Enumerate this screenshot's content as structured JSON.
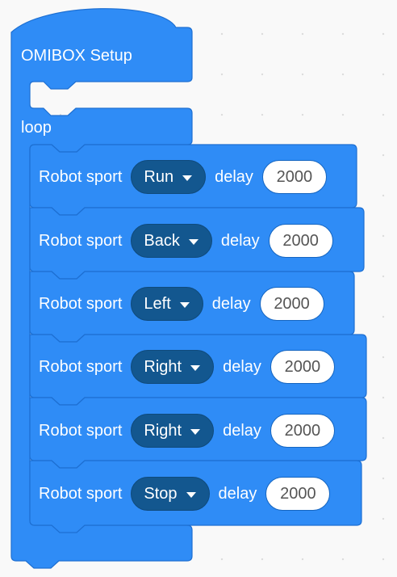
{
  "setup": {
    "title": "OMIBOX Setup"
  },
  "loop": {
    "title": "loop"
  },
  "blocks": [
    {
      "label": "Robot sport",
      "direction": "Run",
      "delay_label": "delay",
      "delay": "2000"
    },
    {
      "label": "Robot sport",
      "direction": "Back",
      "delay_label": "delay",
      "delay": "2000"
    },
    {
      "label": "Robot sport",
      "direction": "Left",
      "delay_label": "delay",
      "delay": "2000"
    },
    {
      "label": "Robot sport",
      "direction": "Right",
      "delay_label": "delay",
      "delay": "2000"
    },
    {
      "label": "Robot sport",
      "direction": "Right",
      "delay_label": "delay",
      "delay": "2000"
    },
    {
      "label": "Robot sport",
      "direction": "Stop",
      "delay_label": "delay",
      "delay": "2000"
    }
  ],
  "colors": {
    "block": "#2f8cf6",
    "block_border": "#1d6fd2",
    "dropdown": "#13578f",
    "workspace": "#f9f9f9"
  }
}
